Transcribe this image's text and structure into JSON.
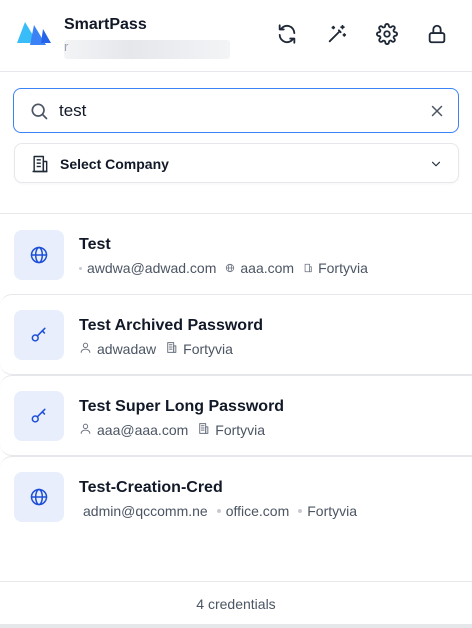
{
  "app": {
    "name": "SmartPass",
    "account_initial": "r",
    "brand_color": "#3b82f6"
  },
  "header_actions": [
    {
      "name": "sync",
      "icon": "refresh-icon"
    },
    {
      "name": "generator",
      "icon": "magic-wand-icon"
    },
    {
      "name": "settings",
      "icon": "gear-icon"
    },
    {
      "name": "lock",
      "icon": "lock-icon"
    }
  ],
  "search": {
    "value": "test",
    "icon": "search-icon",
    "clear_icon": "close-icon"
  },
  "company_select": {
    "label": "Select Company",
    "icon": "building-icon",
    "chevron": "chevron-down-icon"
  },
  "credentials": [
    {
      "title": "Test",
      "type_icon": "globe-icon",
      "username": "awdwa@adwad.com",
      "username_icon": "dot",
      "url": "aaa.com",
      "url_icon": "globe-icon",
      "company": "Fortyvia",
      "company_icon": "building-icon"
    },
    {
      "title": "Test Archived Password",
      "type_icon": "key-icon",
      "username": "adwadaw",
      "username_icon": "user-icon",
      "company": "Fortyvia",
      "company_icon": "building-icon"
    },
    {
      "title": "Test Super Long Password",
      "type_icon": "key-icon",
      "username": "aaa@aaa.com",
      "username_icon": "user-icon",
      "company": "Fortyvia",
      "company_icon": "building-icon"
    },
    {
      "title": "Test-Creation-Cred",
      "type_icon": "globe-icon",
      "username": "admin@qccomm.ne",
      "username_icon": "none",
      "url": "office.com",
      "url_icon": "dot",
      "company": "Fortyvia",
      "company_icon": "dot"
    }
  ],
  "footer": {
    "count_text": "4 credentials"
  }
}
